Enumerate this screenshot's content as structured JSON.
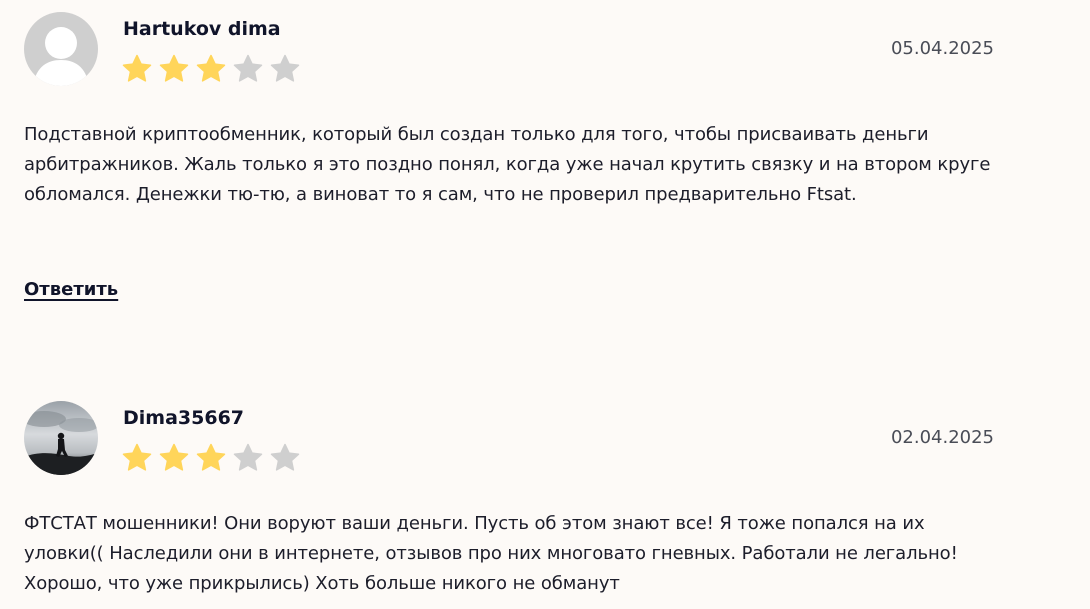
{
  "colors": {
    "background": "#fdfaf7",
    "star_filled": "#ffd55a",
    "star_empty": "#cfcfcf",
    "text": "#1c1d2a",
    "date": "#4a4d57"
  },
  "reviews": [
    {
      "author": "Hartukov dima",
      "date": "05.04.2025",
      "rating": 3,
      "rating_max": 5,
      "avatar_icon": "default-user-avatar-icon",
      "text": "Подставной криптообменник, который был создан только для того, чтобы присваивать деньги арбитражников. Жаль только я это поздно понял, когда уже начал крутить связку и на втором круге обломался. Денежки тю-тю, а виноват то я сам, что не проверил предварительно Ftsat.",
      "reply_label": "Ответить"
    },
    {
      "author": "Dima35667",
      "date": "02.04.2025",
      "rating": 3,
      "rating_max": 5,
      "avatar_icon": "user-photo-avatar",
      "text": "ФТСТАТ мошенники! Они воруют ваши деньги. Пусть об этом знают все! Я тоже попался на их уловки(( Наследили они в интернете, отзывов про них многовато гневных. Работали не легально! Хорошо, что уже прикрылись) Хоть больше никого не обманут"
    }
  ]
}
